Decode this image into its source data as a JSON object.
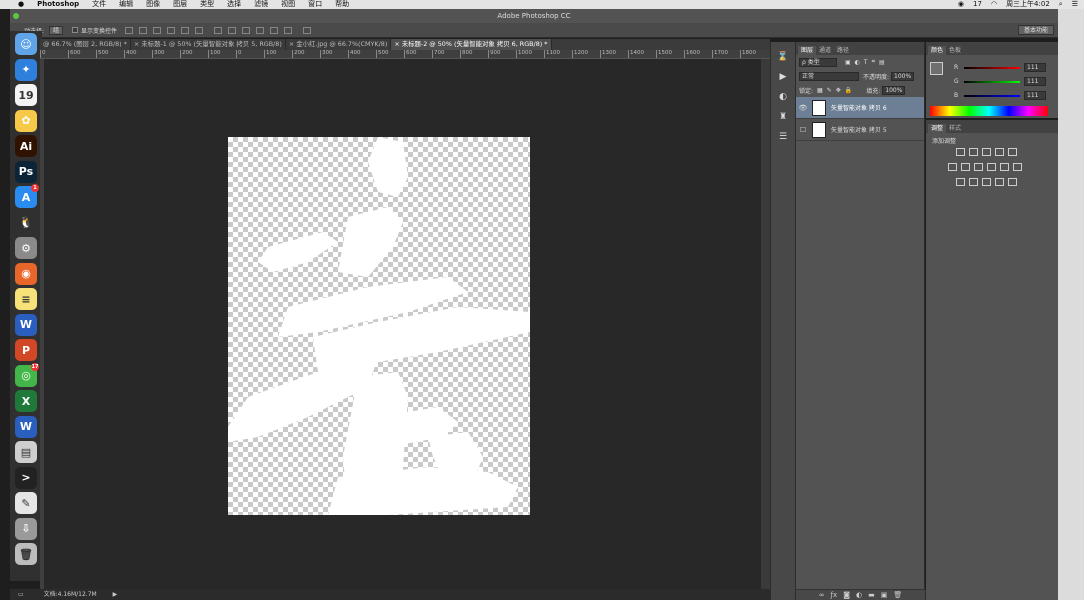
{
  "menubar": {
    "app_name": "Photoshop",
    "items": [
      "文件",
      "编辑",
      "图像",
      "图层",
      "类型",
      "选择",
      "滤镜",
      "视图",
      "窗口",
      "帮助"
    ],
    "status_right": [
      "17",
      "周三上午4:02"
    ]
  },
  "window": {
    "title": "Adobe Photoshop CC"
  },
  "options_bar": {
    "auto_select_label": "动选择:",
    "auto_select_value": "组",
    "transform_label": "显示变换控件",
    "workspace": "基本功能"
  },
  "doc_tabs": [
    "@ 66.7% (图层 2, RGB/8) *",
    "× 未标题-1 @ 50% (矢量智能对象 拷贝 5, RGB/8)",
    "× 金小红.jpg @ 66.7%(CMYK/8)",
    "× 未标题-2 @ 50% (矢量智能对象 拷贝 6, RGB/8) *"
  ],
  "active_tab_index": 3,
  "ruler_labels": [
    "0",
    "600",
    "500",
    "400",
    "300",
    "200",
    "100",
    "0",
    "100",
    "200",
    "300",
    "400",
    "500",
    "600",
    "700",
    "800",
    "900",
    "1000",
    "1100",
    "1200",
    "1300",
    "1400",
    "1500",
    "1600",
    "1700",
    "1800"
  ],
  "status": {
    "doc_info": "文档:4.16M/12.7M"
  },
  "layers_panel": {
    "tabs": [
      "图层",
      "通道",
      "路径"
    ],
    "filter_label": "ρ 类型",
    "blend_mode": "正常",
    "opacity_label": "不透明度:",
    "opacity_value": "100%",
    "lock_label": "锁定:",
    "fill_label": "填充:",
    "fill_value": "100%",
    "layers": [
      {
        "name": "矢量智能对象 拷贝 6",
        "visible": true,
        "selected": true
      },
      {
        "name": "矢量智能对象 拷贝 5",
        "visible": false,
        "selected": false
      }
    ],
    "bottom_icons": [
      "link-icon",
      "fx-icon",
      "mask-icon",
      "adjustment-icon",
      "folder-icon",
      "new-layer-icon",
      "trash-icon"
    ]
  },
  "color_panel": {
    "tabs": [
      "颜色",
      "色板"
    ],
    "channels": [
      {
        "label": "R",
        "value": "111"
      },
      {
        "label": "G",
        "value": "111"
      },
      {
        "label": "B",
        "value": "111"
      }
    ],
    "swatch_color": "#6f6f6f"
  },
  "adjust_panel": {
    "tabs": [
      "调整",
      "样式"
    ],
    "add_label": "添加调整"
  },
  "dock": [
    {
      "name": "finder-icon",
      "color": "#5fa4e8",
      "glyph": "☺"
    },
    {
      "name": "safari-icon",
      "color": "#2f7fdc",
      "glyph": "✦"
    },
    {
      "name": "calendar-icon",
      "color": "#f4f4f4",
      "glyph": "19"
    },
    {
      "name": "photos-icon",
      "color": "#f7c948",
      "glyph": "✿"
    },
    {
      "name": "illustrator-icon",
      "color": "#2f1300",
      "glyph": "Ai"
    },
    {
      "name": "photoshop-icon",
      "color": "#0c2438",
      "glyph": "Ps"
    },
    {
      "name": "app-store-icon",
      "color": "#2a8cf0",
      "glyph": "A",
      "badge": "1"
    },
    {
      "name": "qq-icon",
      "color": "#303030",
      "glyph": "🐧"
    },
    {
      "name": "system-preferences-icon",
      "color": "#8a8a8a",
      "glyph": "⚙"
    },
    {
      "name": "firefox-icon",
      "color": "#e8662a",
      "glyph": "◉"
    },
    {
      "name": "notes-icon",
      "color": "#f7e27a",
      "glyph": "≡"
    },
    {
      "name": "word-icon",
      "color": "#2b5fbf",
      "glyph": "W"
    },
    {
      "name": "powerpoint-icon",
      "color": "#d24726",
      "glyph": "P"
    },
    {
      "name": "wechat-icon",
      "color": "#43b649",
      "glyph": "◎",
      "badge": "17"
    },
    {
      "name": "excel-icon",
      "color": "#1f7a3a",
      "glyph": "X"
    },
    {
      "name": "wps-icon",
      "color": "#2b5fbf",
      "glyph": "W"
    },
    {
      "name": "screenshot-folder-icon",
      "color": "#cfcfcf",
      "glyph": "▤"
    },
    {
      "name": "terminal-icon",
      "color": "#222222",
      "glyph": ">"
    },
    {
      "name": "document-icon",
      "color": "#e6e6e6",
      "glyph": "✎"
    },
    {
      "name": "downloads-icon",
      "color": "#9a9a9a",
      "glyph": "⇩"
    },
    {
      "name": "trash-icon",
      "color": "#bdbdbd",
      "glyph": "🗑"
    }
  ]
}
